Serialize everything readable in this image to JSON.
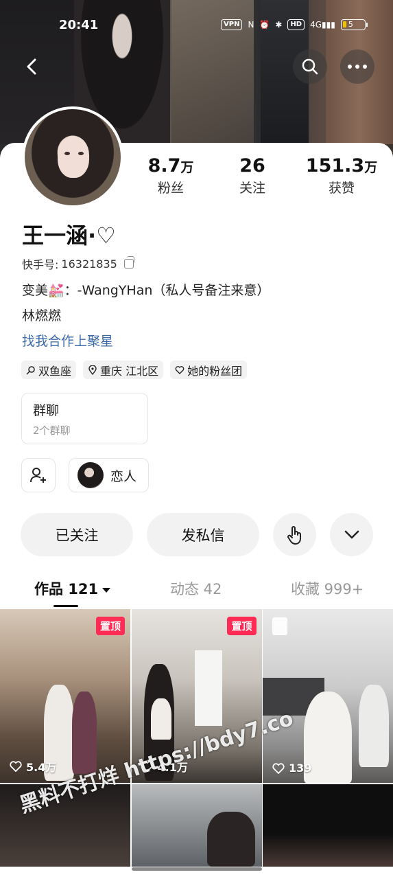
{
  "status_bar": {
    "time": "20:41",
    "vpn": "VPN",
    "hd": "HD",
    "network": "4G",
    "battery": "5"
  },
  "profile": {
    "name": "王一涵·♡",
    "kuaishou_id_label": "快手号:",
    "kuaishou_id": "16321835",
    "bio_line1": "变美💒：-WangYHan（私人号备注来意）",
    "bio_line2": "林燃燃",
    "link_text": "找我合作上聚星"
  },
  "stats": [
    {
      "num": "8.7",
      "unit": "万",
      "label": "粉丝"
    },
    {
      "num": "26",
      "unit": "",
      "label": "关注"
    },
    {
      "num": "151.3",
      "unit": "万",
      "label": "获赞"
    }
  ],
  "tags": [
    {
      "icon": "search-tag-icon",
      "text": "双鱼座"
    },
    {
      "icon": "location-pin-icon",
      "text": "重庆 江北区"
    },
    {
      "icon": "heart-outline-icon",
      "text": "她的粉丝团"
    }
  ],
  "group_chat": {
    "title": "群聊",
    "subtitle": "2个群聊"
  },
  "lover_label": "恋人",
  "actions": {
    "followed": "已关注",
    "message": "发私信"
  },
  "tabs": [
    {
      "label": "作品 121",
      "active": true
    },
    {
      "label": "动态 42",
      "active": false
    },
    {
      "label": "收藏 999+",
      "active": false
    }
  ],
  "videos": [
    {
      "pinned": "置顶",
      "likes": "5.4万"
    },
    {
      "pinned": "置顶",
      "likes": "4.1万"
    },
    {
      "pinned": "",
      "likes": "139"
    }
  ],
  "watermark": "黑料不打烊 https://bdy7.co",
  "colors": {
    "accent": "#fe2c55",
    "link": "#3b6aa8"
  }
}
